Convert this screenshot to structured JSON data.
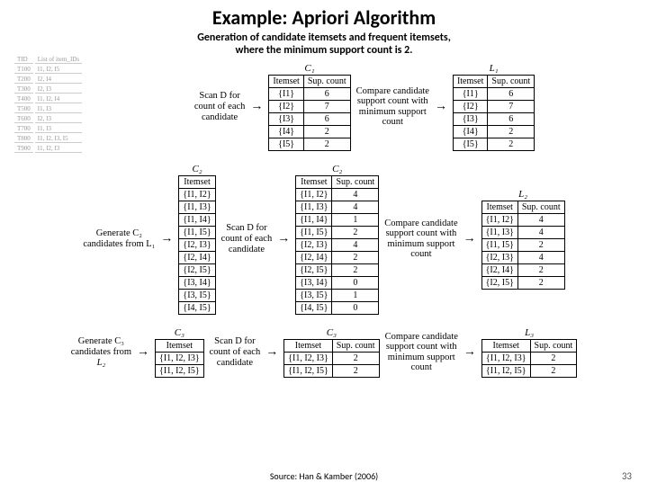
{
  "title": "Example: Apriori Algorithm",
  "subtitle_l1": "Generation of candidate itemsets and frequent itemsets,",
  "subtitle_l2": "where the minimum support count is 2.",
  "source": "Source: Han & Kamber (2006)",
  "page_no": "33",
  "tx": {
    "h1": "TID",
    "h2": "List of item_IDs",
    "r": [
      [
        "T100",
        "I1, I2, I5"
      ],
      [
        "T200",
        "I2, I4"
      ],
      [
        "T300",
        "I2, I3"
      ],
      [
        "T400",
        "I1, I2, I4"
      ],
      [
        "T500",
        "I1, I3"
      ],
      [
        "T600",
        "I2, I3"
      ],
      [
        "T700",
        "I1, I3"
      ],
      [
        "T800",
        "I1, I2, I3, I5"
      ],
      [
        "T900",
        "I1, I2, I3"
      ]
    ]
  },
  "headers": {
    "itemset": "Itemset",
    "sup": "Sup. count"
  },
  "labels": {
    "C1": "C₁",
    "L1": "L₁",
    "C2": "C₂",
    "L2": "L₂",
    "C3": "C₃",
    "L3": "L₃"
  },
  "steps": {
    "scanD": "Scan D for\ncount of each\ncandidate",
    "compare": "Compare candidate\nsupport count with\nminimum support\ncount",
    "genC2a": "Generate C₂",
    "genC2b": "candidates from L₁",
    "genC3a": "Generate C₃",
    "genC3b": "candidates from",
    "genC3c": "L₂"
  },
  "C1": [
    [
      "{I1}",
      "6"
    ],
    [
      "{I2}",
      "7"
    ],
    [
      "{I3}",
      "6"
    ],
    [
      "{I4}",
      "2"
    ],
    [
      "{I5}",
      "2"
    ]
  ],
  "L1": [
    [
      "{I1}",
      "6"
    ],
    [
      "{I2}",
      "7"
    ],
    [
      "{I3}",
      "6"
    ],
    [
      "{I4}",
      "2"
    ],
    [
      "{I5}",
      "2"
    ]
  ],
  "C2a": [
    "{I1, I2}",
    "{I1, I3}",
    "{I1, I4}",
    "{I1, I5}",
    "{I2, I3}",
    "{I2, I4}",
    "{I2, I5}",
    "{I3, I4}",
    "{I3, I5}",
    "{I4, I5}"
  ],
  "C2b": [
    [
      "{I1, I2}",
      "4"
    ],
    [
      "{I1, I3}",
      "4"
    ],
    [
      "{I1, I4}",
      "1"
    ],
    [
      "{I1, I5}",
      "2"
    ],
    [
      "{I2, I3}",
      "4"
    ],
    [
      "{I2, I4}",
      "2"
    ],
    [
      "{I2, I5}",
      "2"
    ],
    [
      "{I3, I4}",
      "0"
    ],
    [
      "{I3, I5}",
      "1"
    ],
    [
      "{I4, I5}",
      "0"
    ]
  ],
  "L2": [
    [
      "{I1, I2}",
      "4"
    ],
    [
      "{I1, I3}",
      "4"
    ],
    [
      "{I1, I5}",
      "2"
    ],
    [
      "{I2, I3}",
      "4"
    ],
    [
      "{I2, I4}",
      "2"
    ],
    [
      "{I2, I5}",
      "2"
    ]
  ],
  "C3a": [
    "{I1, I2, I3}",
    "{I1, I2, I5}"
  ],
  "C3b": [
    [
      "{I1, I2, I3}",
      "2"
    ],
    [
      "{I1, I2, I5}",
      "2"
    ]
  ],
  "L3": [
    [
      "{I1, I2, I3}",
      "2"
    ],
    [
      "{I1, I2, I5}",
      "2"
    ]
  ]
}
